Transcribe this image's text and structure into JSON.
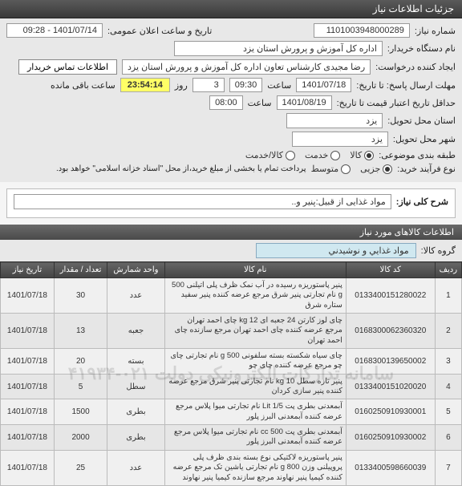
{
  "header": {
    "title": "جزئیات اطلاعات نیاز"
  },
  "info": {
    "need_no_label": "شماره نیاز:",
    "need_no": "1101003948000289",
    "announce_label": "تاریخ و ساعت اعلان عمومی:",
    "announce_value": "1401/07/14 - 09:28",
    "buyer_label": "نام دستگاه خریدار:",
    "buyer_value": "اداره کل آموزش و پرورش استان یزد",
    "requester_label": "ایجاد کننده درخواست:",
    "requester_value": "رضا مجیدی کارشناس تعاون اداره کل آموزش و پرورش استان یزد",
    "contact_btn": "اطلاعات تماس خریدار",
    "deadline_resp_label": "مهلت ارسال پاسخ: تا تاریخ:",
    "deadline_date": "1401/07/18",
    "time_label": "ساعت",
    "deadline_time": "09:30",
    "days_label": "روز",
    "days_value": "3",
    "remaining_label": "ساعت باقی مانده",
    "remaining_value": "23:54:14",
    "validity_label": "حداقل تاریخ اعتبار قیمت تا تاریخ:",
    "validity_date": "1401/08/19",
    "validity_time": "08:00",
    "province_label": "استان محل تحویل:",
    "province_value": "یزد",
    "city_label": "شهر محل تحویل:",
    "city_value": "یزد",
    "subject_cat_label": "طبقه بندی موضوعی:",
    "radio_goods": "کالا",
    "radio_service": "خدمت",
    "radio_both": "کالا/خدمت",
    "purchase_type_label": "نوع فرآیند خرید:",
    "radio_minor": "جزیی",
    "radio_medium": "متوسط",
    "purchase_note": "پرداخت تمام یا بخشی از مبلغ خرید،از محل \"اسناد خزانه اسلامی\" خواهد بود."
  },
  "desc": {
    "label": "شرح کلی نیاز:",
    "value": "مواد غذایی از قبیل:پنیر و.."
  },
  "goods_section": {
    "title": "اطلاعات کالاهای مورد نیاز",
    "group_label": "گروه کالا:",
    "group_value": "مواد غذايي و نوشيدني"
  },
  "table": {
    "headers": {
      "row": "ردیف",
      "code": "کد کالا",
      "name": "نام کالا",
      "unit": "واحد شمارش",
      "qty": "تعداد / مقدار",
      "date": "تاریخ نیاز"
    },
    "rows": [
      {
        "row": "1",
        "code": "0133400151280022",
        "name": "پنیر پاستوریزه رسیده در آب نمک ظرف پلی اتیلنی 500 g نام تجارتی پنیر شرق مرجع عرضه کننده پنیر سفید ستاره شرق",
        "unit": "عدد",
        "qty": "30",
        "date": "1401/07/18"
      },
      {
        "row": "2",
        "code": "0168300062360320",
        "name": "چای لوز کارتن 24 جعبه ای 12 kg چای احمد تهران مرجع عرضه کننده چای احمد تهران مرجع سازنده چای احمد تهران",
        "unit": "جعبه",
        "qty": "13",
        "date": "1401/07/18"
      },
      {
        "row": "3",
        "code": "0168300139650002",
        "name": "چای سیاه شکسته بسته سلفونی 500 g نام تجارتی چای چو مرجع عرضه کننده چای چو",
        "unit": "بسته",
        "qty": "20",
        "date": "1401/07/18"
      },
      {
        "row": "4",
        "code": "0133400151020020",
        "name": "پنیر تازه سطل 10 kg نام تجارتی پنیر شرق مرجع عرضه کننده پنیر سازی کردان",
        "unit": "سطل",
        "qty": "5",
        "date": "1401/07/18"
      },
      {
        "row": "5",
        "code": "0160250910930001",
        "name": "آبمعدنی بطری پت 1/5 Lit نام تجارتی میوا پلاس مرجع عرضه کننده آبمعدنی البرز پلور",
        "unit": "بطری",
        "qty": "1500",
        "date": "1401/07/18"
      },
      {
        "row": "6",
        "code": "0160250910930002",
        "name": "آبمعدنی بطری پت 500 cc نام تجارتی میوا پلاس مرجع عرضه کننده آبمعدنی البرز پلور",
        "unit": "بطری",
        "qty": "2000",
        "date": "1401/07/18"
      },
      {
        "row": "7",
        "code": "0133400598660039",
        "name": "پنیر پاستوریزه لاکتیکی نوع بسته بندی ظرف پلی پروپیلنی وزن 800 g نام تجارتی یاشین تک مرجع عرضه کننده کیمیا پنیر نهاوند مرجع سازنده کیمیا پنیر نهاوند",
        "unit": "عدد",
        "qty": "25",
        "date": "1401/07/18"
      }
    ]
  },
  "watermark": "سامانه تدارکات الکترونیکی دولت  ۰۲۱-۴۱۹۳۴"
}
